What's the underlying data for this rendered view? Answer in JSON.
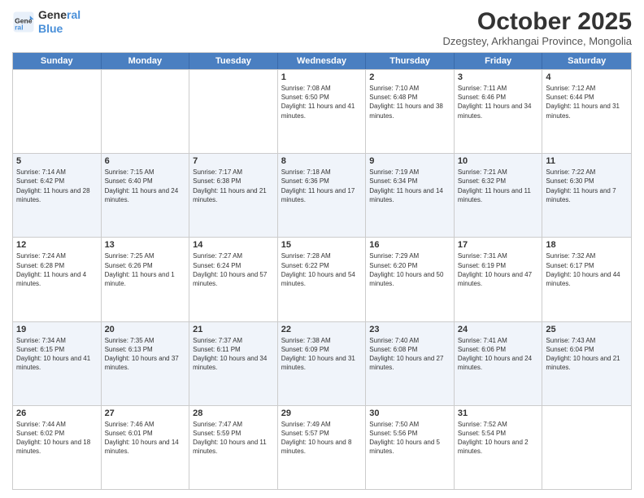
{
  "logo": {
    "line1": "General",
    "line2": "Blue"
  },
  "title": "October 2025",
  "location": "Dzegstey, Arkhangai Province, Mongolia",
  "header_days": [
    "Sunday",
    "Monday",
    "Tuesday",
    "Wednesday",
    "Thursday",
    "Friday",
    "Saturday"
  ],
  "rows": [
    [
      {
        "day": "",
        "sunrise": "",
        "sunset": "",
        "daylight": ""
      },
      {
        "day": "",
        "sunrise": "",
        "sunset": "",
        "daylight": ""
      },
      {
        "day": "",
        "sunrise": "",
        "sunset": "",
        "daylight": ""
      },
      {
        "day": "1",
        "sunrise": "Sunrise: 7:08 AM",
        "sunset": "Sunset: 6:50 PM",
        "daylight": "Daylight: 11 hours and 41 minutes."
      },
      {
        "day": "2",
        "sunrise": "Sunrise: 7:10 AM",
        "sunset": "Sunset: 6:48 PM",
        "daylight": "Daylight: 11 hours and 38 minutes."
      },
      {
        "day": "3",
        "sunrise": "Sunrise: 7:11 AM",
        "sunset": "Sunset: 6:46 PM",
        "daylight": "Daylight: 11 hours and 34 minutes."
      },
      {
        "day": "4",
        "sunrise": "Sunrise: 7:12 AM",
        "sunset": "Sunset: 6:44 PM",
        "daylight": "Daylight: 11 hours and 31 minutes."
      }
    ],
    [
      {
        "day": "5",
        "sunrise": "Sunrise: 7:14 AM",
        "sunset": "Sunset: 6:42 PM",
        "daylight": "Daylight: 11 hours and 28 minutes."
      },
      {
        "day": "6",
        "sunrise": "Sunrise: 7:15 AM",
        "sunset": "Sunset: 6:40 PM",
        "daylight": "Daylight: 11 hours and 24 minutes."
      },
      {
        "day": "7",
        "sunrise": "Sunrise: 7:17 AM",
        "sunset": "Sunset: 6:38 PM",
        "daylight": "Daylight: 11 hours and 21 minutes."
      },
      {
        "day": "8",
        "sunrise": "Sunrise: 7:18 AM",
        "sunset": "Sunset: 6:36 PM",
        "daylight": "Daylight: 11 hours and 17 minutes."
      },
      {
        "day": "9",
        "sunrise": "Sunrise: 7:19 AM",
        "sunset": "Sunset: 6:34 PM",
        "daylight": "Daylight: 11 hours and 14 minutes."
      },
      {
        "day": "10",
        "sunrise": "Sunrise: 7:21 AM",
        "sunset": "Sunset: 6:32 PM",
        "daylight": "Daylight: 11 hours and 11 minutes."
      },
      {
        "day": "11",
        "sunrise": "Sunrise: 7:22 AM",
        "sunset": "Sunset: 6:30 PM",
        "daylight": "Daylight: 11 hours and 7 minutes."
      }
    ],
    [
      {
        "day": "12",
        "sunrise": "Sunrise: 7:24 AM",
        "sunset": "Sunset: 6:28 PM",
        "daylight": "Daylight: 11 hours and 4 minutes."
      },
      {
        "day": "13",
        "sunrise": "Sunrise: 7:25 AM",
        "sunset": "Sunset: 6:26 PM",
        "daylight": "Daylight: 11 hours and 1 minute."
      },
      {
        "day": "14",
        "sunrise": "Sunrise: 7:27 AM",
        "sunset": "Sunset: 6:24 PM",
        "daylight": "Daylight: 10 hours and 57 minutes."
      },
      {
        "day": "15",
        "sunrise": "Sunrise: 7:28 AM",
        "sunset": "Sunset: 6:22 PM",
        "daylight": "Daylight: 10 hours and 54 minutes."
      },
      {
        "day": "16",
        "sunrise": "Sunrise: 7:29 AM",
        "sunset": "Sunset: 6:20 PM",
        "daylight": "Daylight: 10 hours and 50 minutes."
      },
      {
        "day": "17",
        "sunrise": "Sunrise: 7:31 AM",
        "sunset": "Sunset: 6:19 PM",
        "daylight": "Daylight: 10 hours and 47 minutes."
      },
      {
        "day": "18",
        "sunrise": "Sunrise: 7:32 AM",
        "sunset": "Sunset: 6:17 PM",
        "daylight": "Daylight: 10 hours and 44 minutes."
      }
    ],
    [
      {
        "day": "19",
        "sunrise": "Sunrise: 7:34 AM",
        "sunset": "Sunset: 6:15 PM",
        "daylight": "Daylight: 10 hours and 41 minutes."
      },
      {
        "day": "20",
        "sunrise": "Sunrise: 7:35 AM",
        "sunset": "Sunset: 6:13 PM",
        "daylight": "Daylight: 10 hours and 37 minutes."
      },
      {
        "day": "21",
        "sunrise": "Sunrise: 7:37 AM",
        "sunset": "Sunset: 6:11 PM",
        "daylight": "Daylight: 10 hours and 34 minutes."
      },
      {
        "day": "22",
        "sunrise": "Sunrise: 7:38 AM",
        "sunset": "Sunset: 6:09 PM",
        "daylight": "Daylight: 10 hours and 31 minutes."
      },
      {
        "day": "23",
        "sunrise": "Sunrise: 7:40 AM",
        "sunset": "Sunset: 6:08 PM",
        "daylight": "Daylight: 10 hours and 27 minutes."
      },
      {
        "day": "24",
        "sunrise": "Sunrise: 7:41 AM",
        "sunset": "Sunset: 6:06 PM",
        "daylight": "Daylight: 10 hours and 24 minutes."
      },
      {
        "day": "25",
        "sunrise": "Sunrise: 7:43 AM",
        "sunset": "Sunset: 6:04 PM",
        "daylight": "Daylight: 10 hours and 21 minutes."
      }
    ],
    [
      {
        "day": "26",
        "sunrise": "Sunrise: 7:44 AM",
        "sunset": "Sunset: 6:02 PM",
        "daylight": "Daylight: 10 hours and 18 minutes."
      },
      {
        "day": "27",
        "sunrise": "Sunrise: 7:46 AM",
        "sunset": "Sunset: 6:01 PM",
        "daylight": "Daylight: 10 hours and 14 minutes."
      },
      {
        "day": "28",
        "sunrise": "Sunrise: 7:47 AM",
        "sunset": "Sunset: 5:59 PM",
        "daylight": "Daylight: 10 hours and 11 minutes."
      },
      {
        "day": "29",
        "sunrise": "Sunrise: 7:49 AM",
        "sunset": "Sunset: 5:57 PM",
        "daylight": "Daylight: 10 hours and 8 minutes."
      },
      {
        "day": "30",
        "sunrise": "Sunrise: 7:50 AM",
        "sunset": "Sunset: 5:56 PM",
        "daylight": "Daylight: 10 hours and 5 minutes."
      },
      {
        "day": "31",
        "sunrise": "Sunrise: 7:52 AM",
        "sunset": "Sunset: 5:54 PM",
        "daylight": "Daylight: 10 hours and 2 minutes."
      },
      {
        "day": "",
        "sunrise": "",
        "sunset": "",
        "daylight": ""
      }
    ]
  ]
}
